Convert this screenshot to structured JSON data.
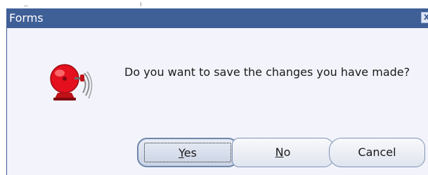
{
  "window": {
    "title": "Forms",
    "close_glyph": "x"
  },
  "dialog": {
    "icon": "alarm-bell-icon",
    "message": "Do you want to save the changes you have made?",
    "buttons": {
      "yes": {
        "mnemonic": "Y",
        "rest": "es"
      },
      "no": {
        "mnemonic": "N",
        "rest": "o"
      },
      "cancel": {
        "label": "Cancel"
      }
    }
  },
  "colors": {
    "titlebar": "#3f5f97",
    "dialog_background": "#f3f4fb",
    "bell_red": "#e4101e"
  }
}
